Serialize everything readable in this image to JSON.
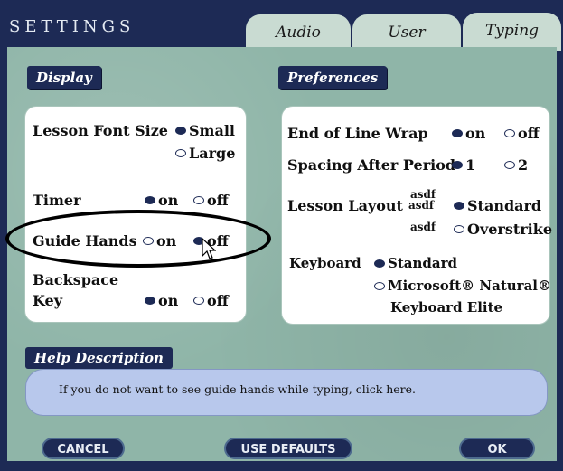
{
  "window": {
    "title": "SETTINGS"
  },
  "tabs": [
    {
      "label": "Audio"
    },
    {
      "label": "User"
    },
    {
      "label": "Typing",
      "active": true
    }
  ],
  "display": {
    "heading": "Display",
    "lesson_font_size": {
      "label": "Lesson Font Size",
      "options": [
        "Small",
        "Large"
      ],
      "selected": "Small"
    },
    "timer": {
      "label": "Timer",
      "options": [
        "on",
        "off"
      ],
      "selected": "on"
    },
    "guide_hands": {
      "label": "Guide Hands",
      "options": [
        "on",
        "off"
      ],
      "selected": "off"
    },
    "backspace_key": {
      "label_line1": "Backspace",
      "label_line2": "Key",
      "options": [
        "on",
        "off"
      ],
      "selected": "on"
    }
  },
  "preferences": {
    "heading": "Preferences",
    "end_of_line_wrap": {
      "label": "End of Line Wrap",
      "options": [
        "on",
        "off"
      ],
      "selected": "on"
    },
    "spacing_after_period": {
      "label": "Spacing After Period",
      "options": [
        "1",
        "2"
      ],
      "selected": "1"
    },
    "lesson_layout": {
      "label": "Lesson Layout",
      "standard_sample": [
        "asdf",
        "asdf"
      ],
      "overstrike_sample": "asdf",
      "options": [
        "Standard",
        "Overstrike"
      ],
      "selected": "Standard"
    },
    "keyboard": {
      "label": "Keyboard",
      "options": [
        "Standard",
        "Microsoft® Natural®"
      ],
      "option2_line2": "Keyboard Elite",
      "selected": "Standard"
    }
  },
  "help": {
    "heading": "Help Description",
    "text": "If you do not want to see guide hands while typing, click here."
  },
  "buttons": {
    "cancel": "CANCEL",
    "defaults": "USE DEFAULTS",
    "ok": "OK"
  },
  "colors": {
    "navy": "#1d2a55",
    "panel": "#8fb5a8",
    "tab": "#c9dbd2",
    "help_box": "#b8c8ec"
  },
  "icons": {
    "cursor": "arrow-cursor-icon",
    "highlight": "ellipse-annotation"
  }
}
